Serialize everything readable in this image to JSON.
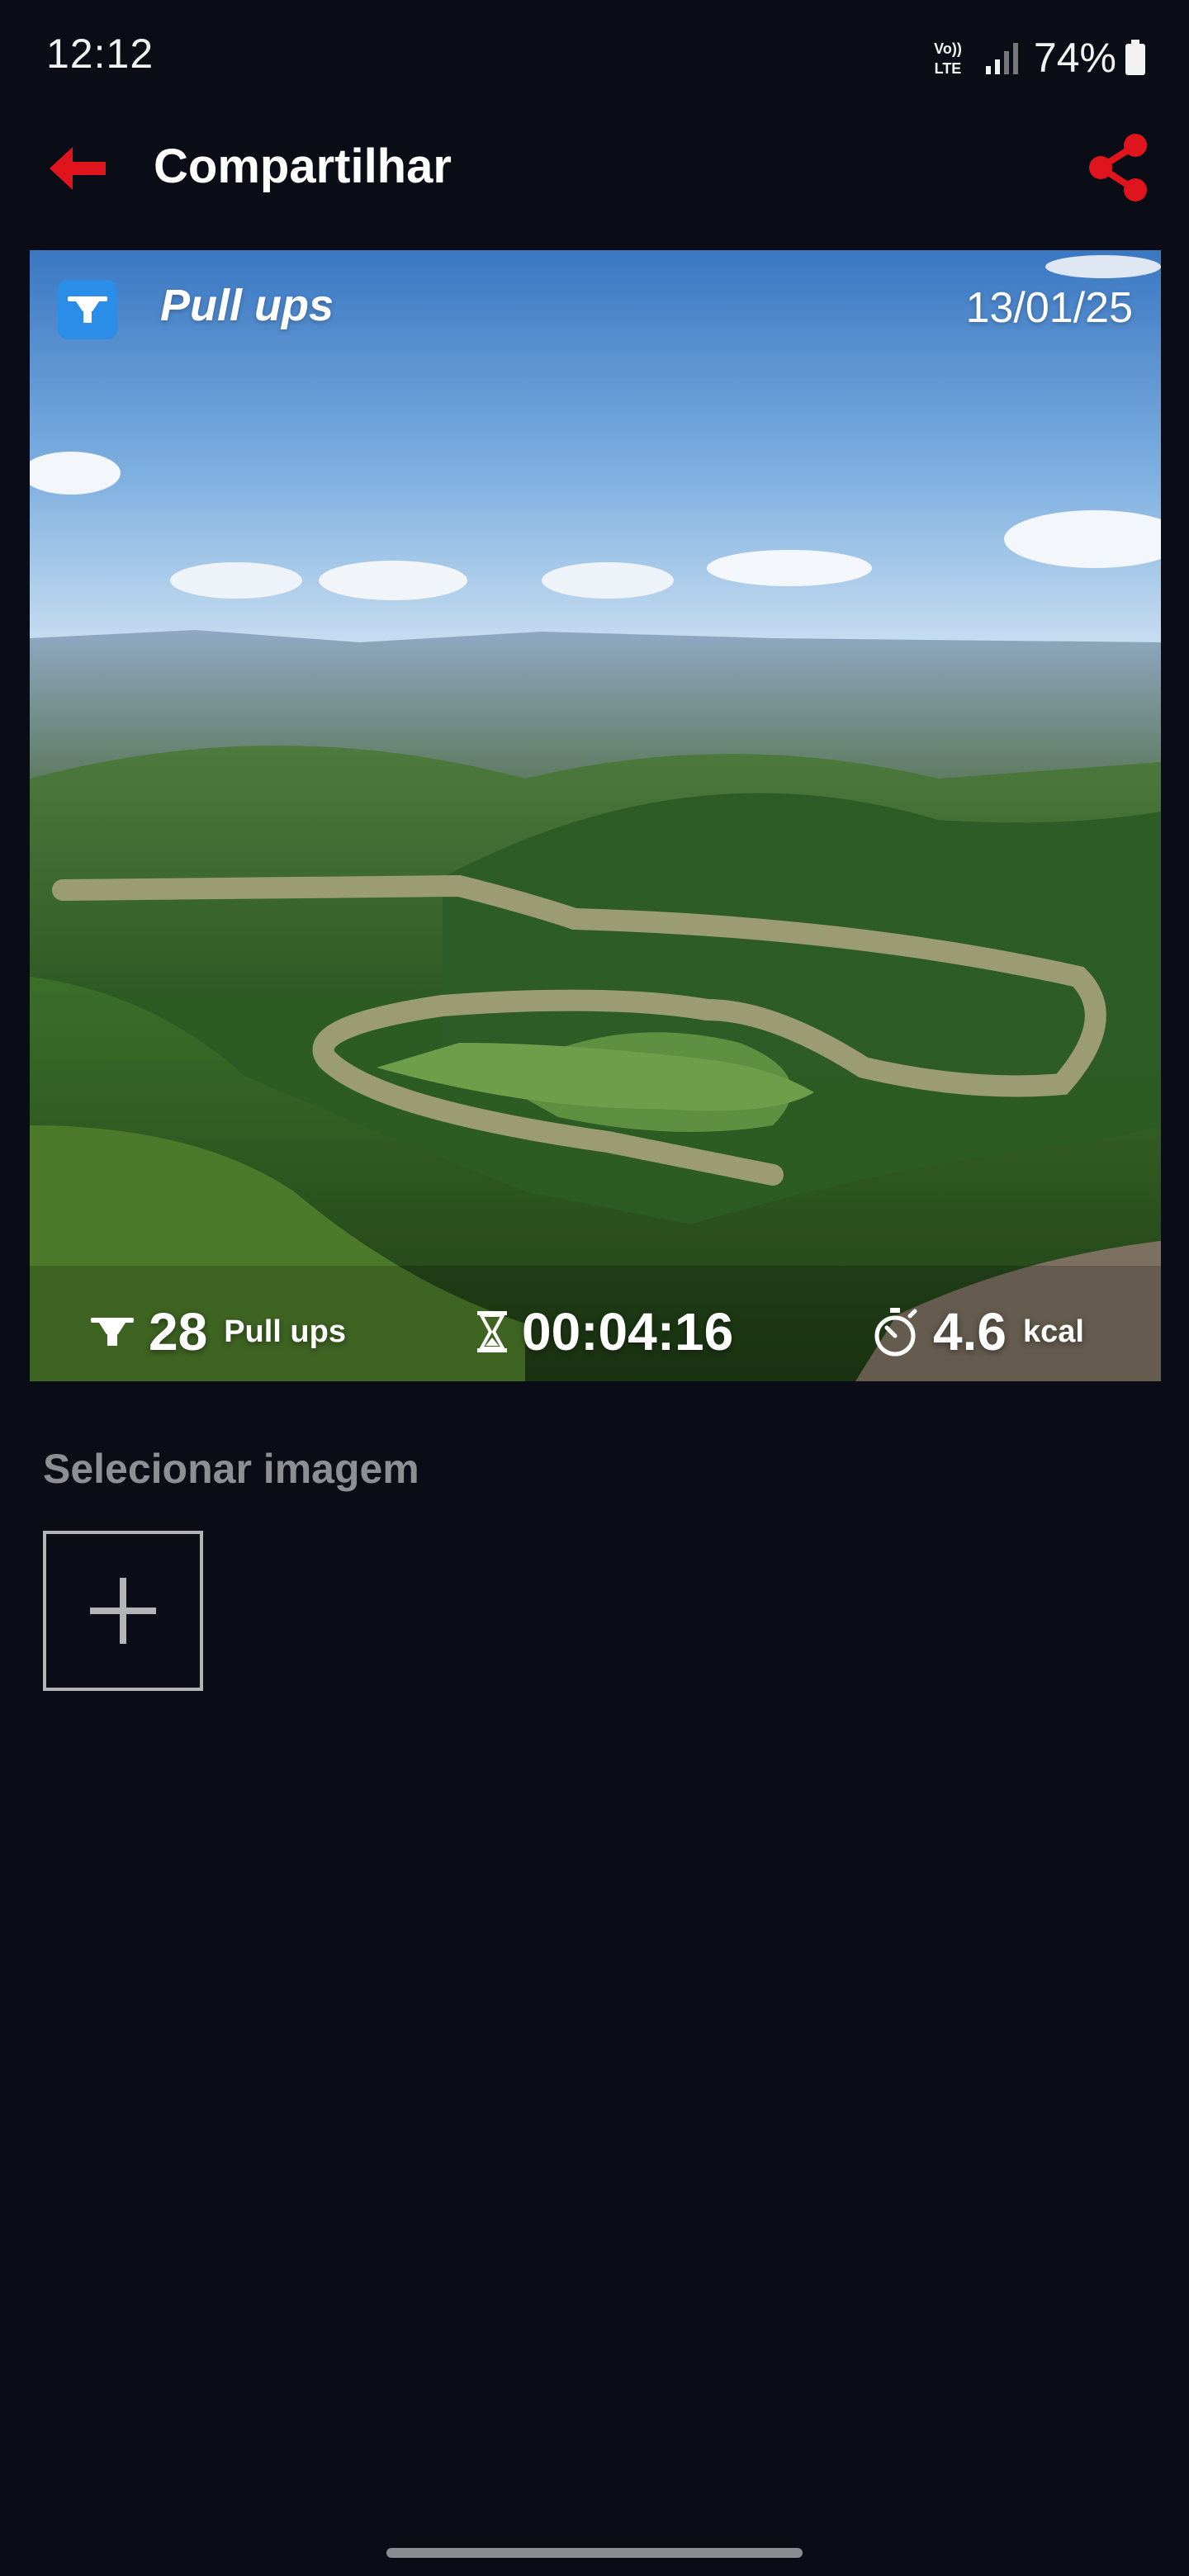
{
  "status_bar": {
    "time": "12:12",
    "network_label": "Vo) LTE",
    "battery_percent": "74%"
  },
  "app_bar": {
    "title": "Compartilhar",
    "back_icon": "arrow-left-icon",
    "share_icon": "share-icon",
    "accent_color": "#e0141d"
  },
  "preview": {
    "workout_icon": "workout-icon",
    "workout_name": "Pull ups",
    "date": "13/01/25",
    "stats": {
      "reps_value": "28",
      "reps_label": "Pull ups",
      "duration": "00:04:16",
      "calories_value": "4.6",
      "calories_unit": "kcal"
    },
    "badge_color": "#2a8de8"
  },
  "image_picker": {
    "title": "Selecionar imagem",
    "add_icon": "plus-icon"
  }
}
